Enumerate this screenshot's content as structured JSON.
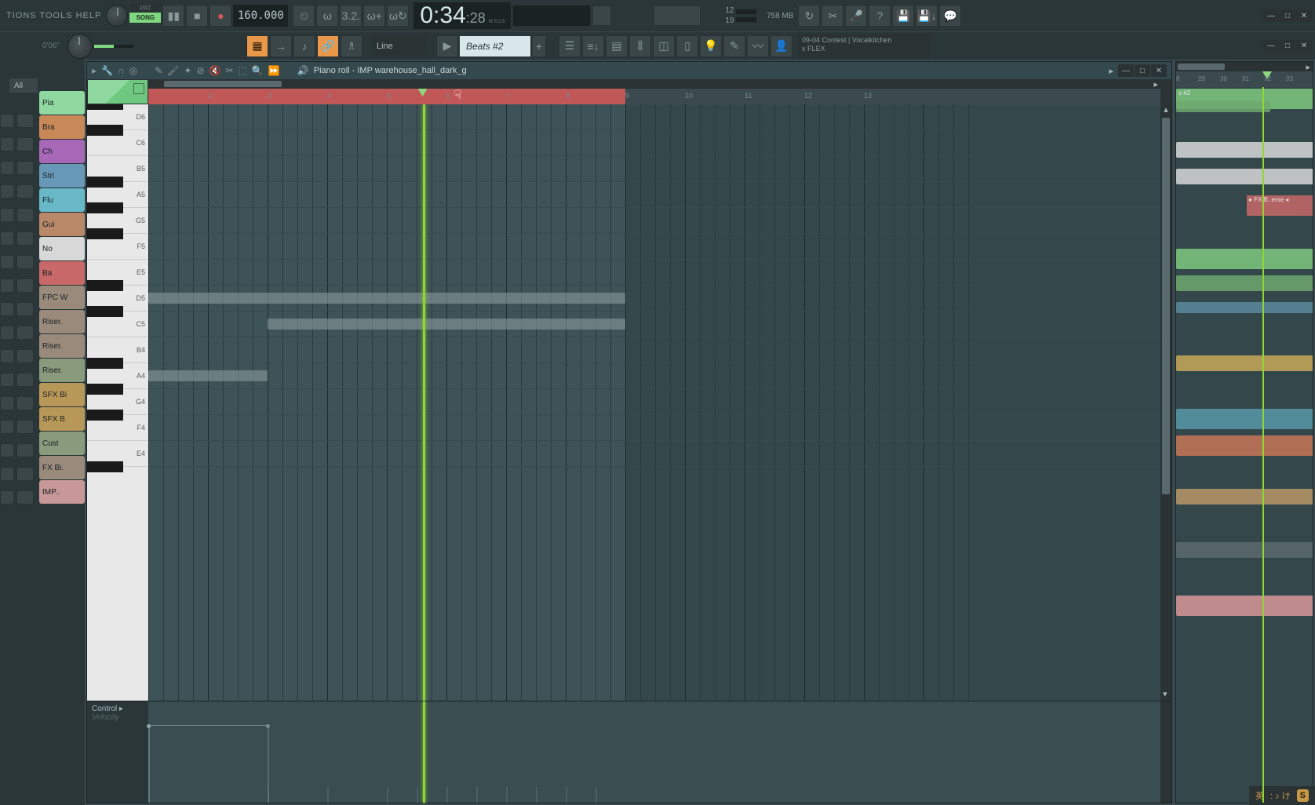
{
  "menu": {
    "items": "TIONS TOOLS HELP"
  },
  "transport": {
    "pat": "PAT",
    "song": "SONG",
    "tempo": "160.000",
    "time_main": "0:34",
    "time_sub": ":28",
    "time_label": "M:S:CS"
  },
  "cpu": {
    "val1": "12",
    "val2": "758 MB",
    "val3": "19"
  },
  "hint_time": "0'06\"",
  "snap": "Line",
  "pattern": "Beats #2",
  "project_hint": {
    "line1": "09-04  Contest | Vocalkitchen",
    "line2": "x FLEX"
  },
  "browser_tab": "All",
  "channels": [
    {
      "name": "Pia",
      "color": "#8fd89f"
    },
    {
      "name": "Bra",
      "color": "#c88858"
    },
    {
      "name": "Ch",
      "color": "#a868b8"
    },
    {
      "name": "Stri",
      "color": "#6898b8"
    },
    {
      "name": "Flu",
      "color": "#68b8c8"
    },
    {
      "name": "Gui",
      "color": "#b88868"
    },
    {
      "name": "No",
      "color": "#d8d8d8"
    },
    {
      "name": "Ba",
      "color": "#c86868"
    },
    {
      "name": "FPC W",
      "color": "#9a8a7c"
    },
    {
      "name": "Riser.",
      "color": "#9a8a7c"
    },
    {
      "name": "Riser.",
      "color": "#9a8a7c"
    },
    {
      "name": "Riser.",
      "color": "#8a9a7c"
    },
    {
      "name": "SFX Bi",
      "color": "#b89858"
    },
    {
      "name": "SFX B",
      "color": "#b89858"
    },
    {
      "name": "Cust",
      "color": "#8a9a7c"
    },
    {
      "name": "FX Bi.",
      "color": "#9a8a7c"
    },
    {
      "name": "IMP..",
      "color": "#c89898"
    }
  ],
  "piano_roll": {
    "title": "Piano roll - IMP warehouse_hall_dark_g",
    "bars": [
      "2",
      "3",
      "4",
      "5",
      "6",
      "7",
      "8",
      "9",
      "10",
      "11",
      "12",
      "13"
    ],
    "key_labels": [
      "D6",
      "C6",
      "B5",
      "A5",
      "G5",
      "F5",
      "E5",
      "D5",
      "C5",
      "B4",
      "A4",
      "G4",
      "F4",
      "E4"
    ],
    "control_label": "Control",
    "control_sublabel": "Velocity",
    "playhead_bar": 5.6,
    "pattern_end_bar": 9,
    "notes": [
      {
        "key": "D5",
        "start": 1,
        "len": 8
      },
      {
        "key": "C5",
        "start": 3,
        "len": 6
      },
      {
        "key": "A4",
        "start": 1,
        "len": 2
      }
    ]
  },
  "playlist": {
    "ruler": [
      "8",
      "29",
      "30",
      "31",
      "32",
      "33"
    ],
    "header_clip": "s #2",
    "fx_label": "▸ FX B..erse ◂"
  },
  "ime": {
    "lang": "英",
    "icons": ": ♪ け"
  }
}
